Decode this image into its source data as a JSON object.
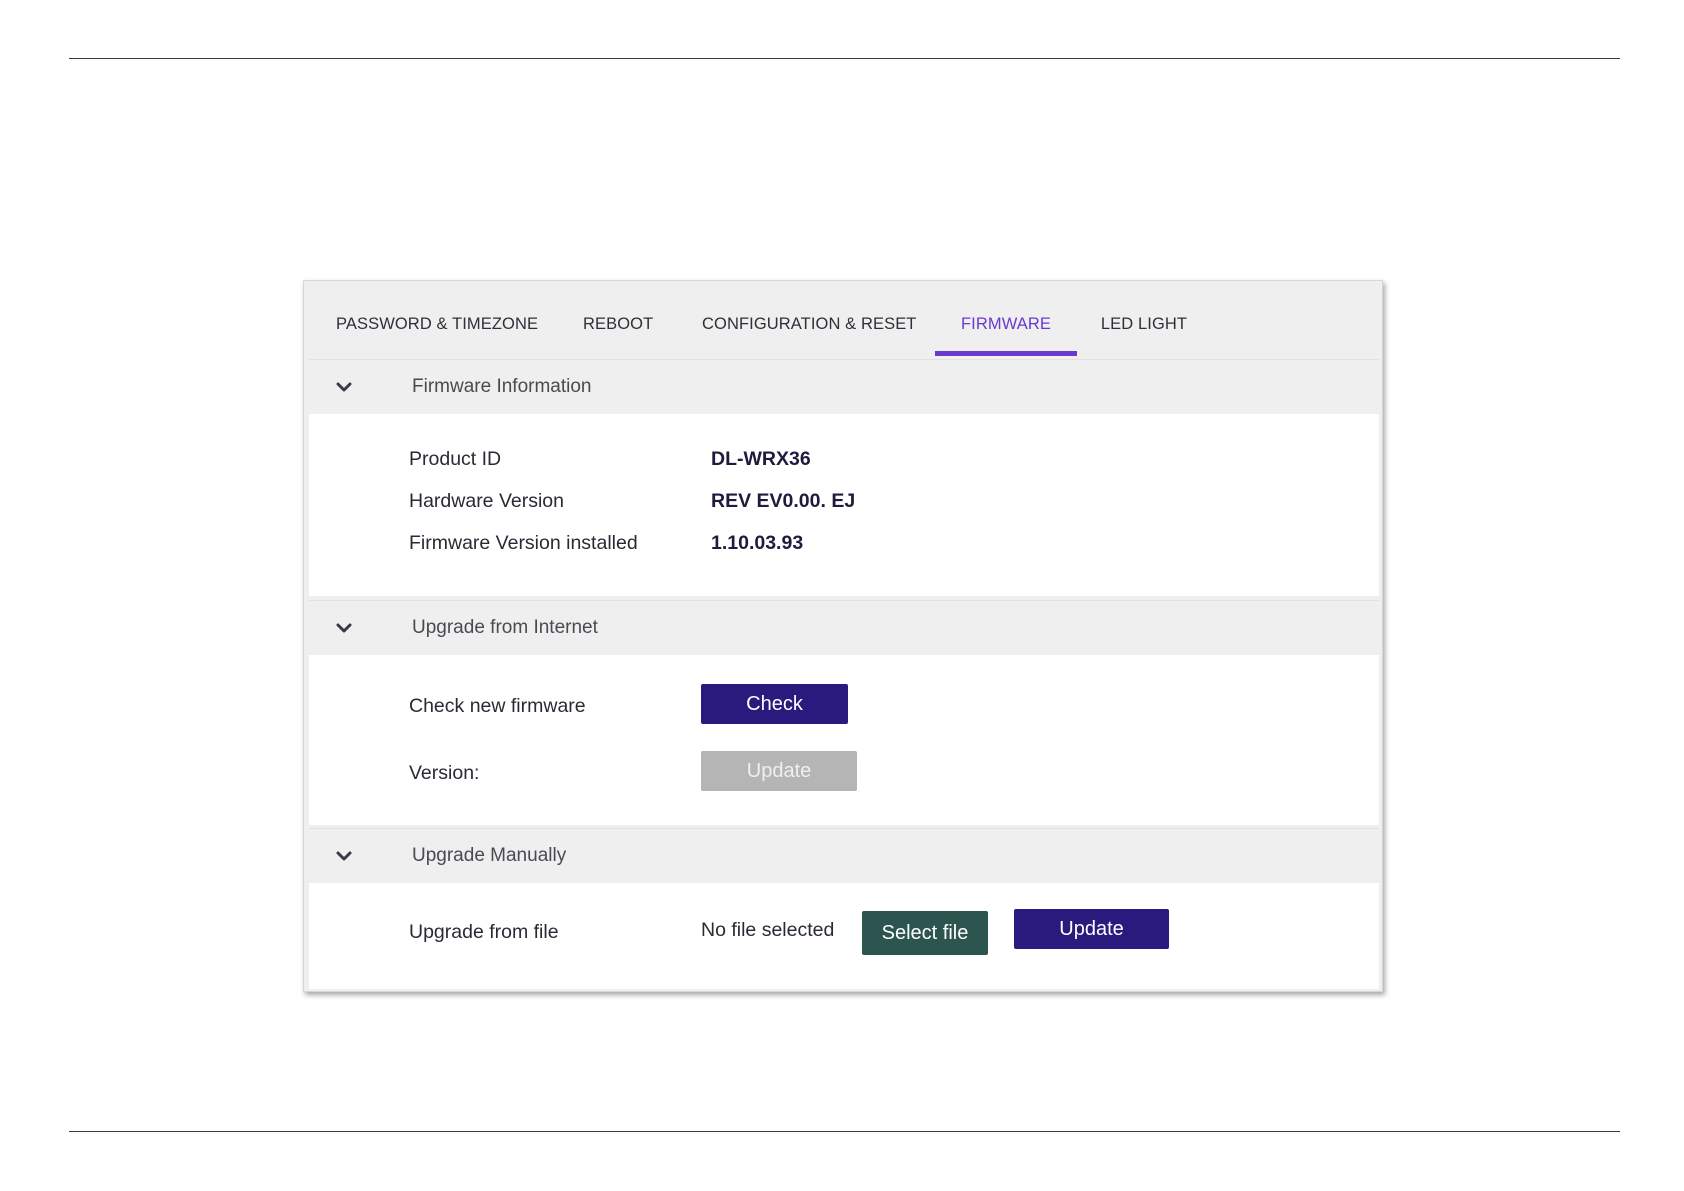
{
  "tabs": [
    {
      "label": "PASSWORD & TIMEZONE"
    },
    {
      "label": "REBOOT"
    },
    {
      "label": "CONFIGURATION & RESET"
    },
    {
      "label": "FIRMWARE"
    },
    {
      "label": "LED LIGHT"
    }
  ],
  "active_tab": "FIRMWARE",
  "accent_color": "#6a3ad0",
  "primary_button_color": "#2a1a7e",
  "file_button_color": "#2d554f",
  "sections": {
    "firmware_info": {
      "title": "Firmware Information",
      "icon": "chevron-down-icon",
      "rows": [
        {
          "label": "Product ID",
          "value": "DL-WRX36"
        },
        {
          "label": "Hardware Version",
          "value": "REV EV0.00. EJ"
        },
        {
          "label": "Firmware Version installed",
          "value": "1.10.03.93"
        }
      ]
    },
    "upgrade_internet": {
      "title": "Upgrade from Internet",
      "icon": "chevron-down-icon",
      "check_label": "Check new firmware",
      "check_button": "Check",
      "version_label": "Version:",
      "update_button": "Update"
    },
    "upgrade_manual": {
      "title": "Upgrade Manually",
      "icon": "chevron-down-icon",
      "file_label": "Upgrade from file",
      "file_status": "No file selected",
      "select_button": "Select file",
      "update_button": "Update"
    }
  }
}
